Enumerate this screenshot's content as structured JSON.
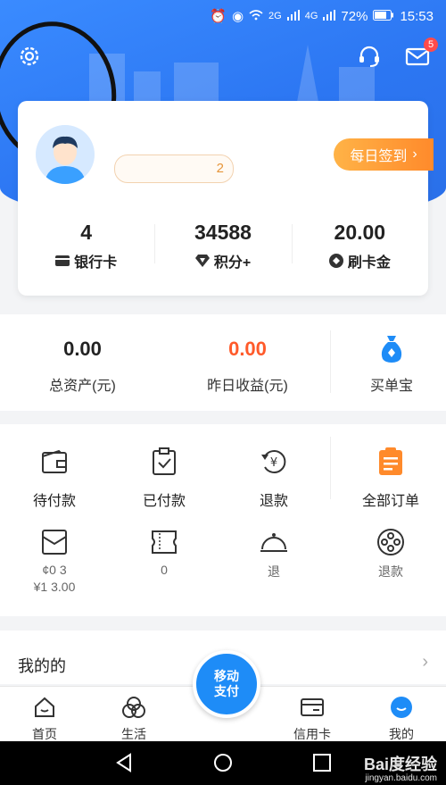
{
  "status_bar": {
    "icons": [
      "alarm-icon",
      "eye-icon",
      "wifi-icon",
      "signal-icon",
      "signal-icon"
    ],
    "net1": "2G",
    "net2": "4G",
    "battery": "72%",
    "time": "15:53"
  },
  "header": {
    "message_badge": "5"
  },
  "profile": {
    "level": "2",
    "checkin_label": "每日签到"
  },
  "stats": [
    {
      "value": "4",
      "label": "银行卡",
      "icon": "card-icon"
    },
    {
      "value": "34588",
      "label": "积分+",
      "icon": "diamond-icon"
    },
    {
      "value": "20.00",
      "label": "刷卡金",
      "icon": "coin-icon"
    }
  ],
  "assets": {
    "total": {
      "value": "0.00",
      "label": "总资产(元)"
    },
    "yesterday": {
      "value": "0.00",
      "label": "昨日收益(元)",
      "color": "#ff5a2a"
    },
    "product": {
      "label": "买单宝"
    }
  },
  "orders": {
    "row1": [
      {
        "label": "待付款",
        "icon": "wallet-icon"
      },
      {
        "label": "已付款",
        "icon": "clipboard-check-icon"
      },
      {
        "label": "退款",
        "icon": "refund-yen-icon"
      },
      {
        "label": "全部订单",
        "icon": "orders-list-icon"
      }
    ],
    "row2": [
      {
        "line1": "¢0 3",
        "line2": "¥1 3.00",
        "icon": "envelope-icon"
      },
      {
        "line1": "",
        "line2": "0",
        "icon": "ticket-icon"
      },
      {
        "line1": "",
        "line2": "退",
        "icon": "dome-icon"
      },
      {
        "line1": "",
        "line2": "退款",
        "icon": "film-reel-icon"
      }
    ]
  },
  "mine": {
    "title": "我的的"
  },
  "tabbar": [
    {
      "label": "首页",
      "icon": "home-icon"
    },
    {
      "label": "生活",
      "icon": "life-icon"
    },
    {
      "label": "移动支付",
      "icon": "pay-icon"
    },
    {
      "label": "信用卡",
      "icon": "creditcard-icon"
    },
    {
      "label": "我的",
      "icon": "me-icon"
    }
  ],
  "pay_button": {
    "line1": "移动",
    "line2": "支付"
  },
  "watermark": {
    "main": "Bai度经验",
    "sub": "jingyan.baidu.com"
  },
  "colors": {
    "primary": "#2c76f2",
    "orange": "#ff8a2b",
    "red": "#ff5a2a"
  }
}
